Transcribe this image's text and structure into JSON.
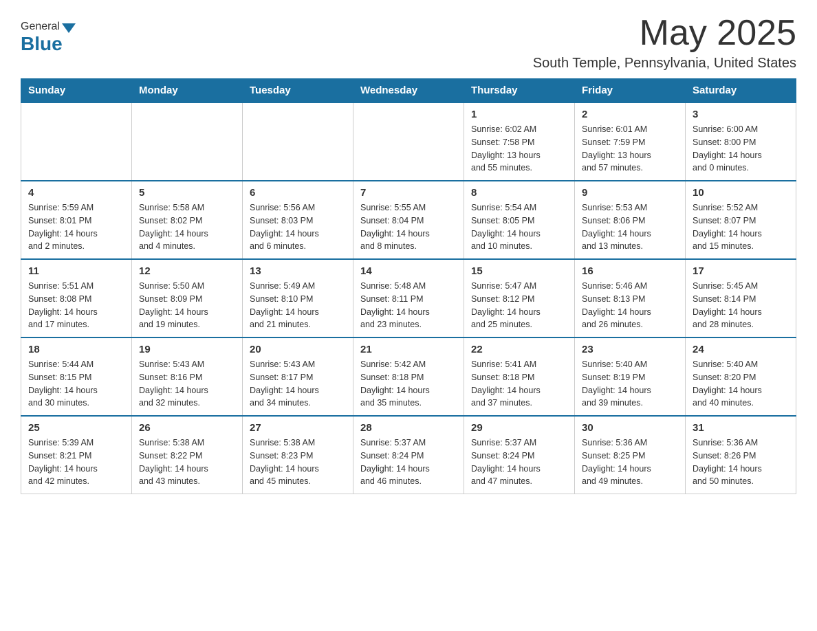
{
  "header": {
    "logo_general": "General",
    "logo_blue": "Blue",
    "month": "May 2025",
    "location": "South Temple, Pennsylvania, United States"
  },
  "days_of_week": [
    "Sunday",
    "Monday",
    "Tuesday",
    "Wednesday",
    "Thursday",
    "Friday",
    "Saturday"
  ],
  "weeks": [
    [
      {
        "day": "",
        "info": ""
      },
      {
        "day": "",
        "info": ""
      },
      {
        "day": "",
        "info": ""
      },
      {
        "day": "",
        "info": ""
      },
      {
        "day": "1",
        "info": "Sunrise: 6:02 AM\nSunset: 7:58 PM\nDaylight: 13 hours\nand 55 minutes."
      },
      {
        "day": "2",
        "info": "Sunrise: 6:01 AM\nSunset: 7:59 PM\nDaylight: 13 hours\nand 57 minutes."
      },
      {
        "day": "3",
        "info": "Sunrise: 6:00 AM\nSunset: 8:00 PM\nDaylight: 14 hours\nand 0 minutes."
      }
    ],
    [
      {
        "day": "4",
        "info": "Sunrise: 5:59 AM\nSunset: 8:01 PM\nDaylight: 14 hours\nand 2 minutes."
      },
      {
        "day": "5",
        "info": "Sunrise: 5:58 AM\nSunset: 8:02 PM\nDaylight: 14 hours\nand 4 minutes."
      },
      {
        "day": "6",
        "info": "Sunrise: 5:56 AM\nSunset: 8:03 PM\nDaylight: 14 hours\nand 6 minutes."
      },
      {
        "day": "7",
        "info": "Sunrise: 5:55 AM\nSunset: 8:04 PM\nDaylight: 14 hours\nand 8 minutes."
      },
      {
        "day": "8",
        "info": "Sunrise: 5:54 AM\nSunset: 8:05 PM\nDaylight: 14 hours\nand 10 minutes."
      },
      {
        "day": "9",
        "info": "Sunrise: 5:53 AM\nSunset: 8:06 PM\nDaylight: 14 hours\nand 13 minutes."
      },
      {
        "day": "10",
        "info": "Sunrise: 5:52 AM\nSunset: 8:07 PM\nDaylight: 14 hours\nand 15 minutes."
      }
    ],
    [
      {
        "day": "11",
        "info": "Sunrise: 5:51 AM\nSunset: 8:08 PM\nDaylight: 14 hours\nand 17 minutes."
      },
      {
        "day": "12",
        "info": "Sunrise: 5:50 AM\nSunset: 8:09 PM\nDaylight: 14 hours\nand 19 minutes."
      },
      {
        "day": "13",
        "info": "Sunrise: 5:49 AM\nSunset: 8:10 PM\nDaylight: 14 hours\nand 21 minutes."
      },
      {
        "day": "14",
        "info": "Sunrise: 5:48 AM\nSunset: 8:11 PM\nDaylight: 14 hours\nand 23 minutes."
      },
      {
        "day": "15",
        "info": "Sunrise: 5:47 AM\nSunset: 8:12 PM\nDaylight: 14 hours\nand 25 minutes."
      },
      {
        "day": "16",
        "info": "Sunrise: 5:46 AM\nSunset: 8:13 PM\nDaylight: 14 hours\nand 26 minutes."
      },
      {
        "day": "17",
        "info": "Sunrise: 5:45 AM\nSunset: 8:14 PM\nDaylight: 14 hours\nand 28 minutes."
      }
    ],
    [
      {
        "day": "18",
        "info": "Sunrise: 5:44 AM\nSunset: 8:15 PM\nDaylight: 14 hours\nand 30 minutes."
      },
      {
        "day": "19",
        "info": "Sunrise: 5:43 AM\nSunset: 8:16 PM\nDaylight: 14 hours\nand 32 minutes."
      },
      {
        "day": "20",
        "info": "Sunrise: 5:43 AM\nSunset: 8:17 PM\nDaylight: 14 hours\nand 34 minutes."
      },
      {
        "day": "21",
        "info": "Sunrise: 5:42 AM\nSunset: 8:18 PM\nDaylight: 14 hours\nand 35 minutes."
      },
      {
        "day": "22",
        "info": "Sunrise: 5:41 AM\nSunset: 8:18 PM\nDaylight: 14 hours\nand 37 minutes."
      },
      {
        "day": "23",
        "info": "Sunrise: 5:40 AM\nSunset: 8:19 PM\nDaylight: 14 hours\nand 39 minutes."
      },
      {
        "day": "24",
        "info": "Sunrise: 5:40 AM\nSunset: 8:20 PM\nDaylight: 14 hours\nand 40 minutes."
      }
    ],
    [
      {
        "day": "25",
        "info": "Sunrise: 5:39 AM\nSunset: 8:21 PM\nDaylight: 14 hours\nand 42 minutes."
      },
      {
        "day": "26",
        "info": "Sunrise: 5:38 AM\nSunset: 8:22 PM\nDaylight: 14 hours\nand 43 minutes."
      },
      {
        "day": "27",
        "info": "Sunrise: 5:38 AM\nSunset: 8:23 PM\nDaylight: 14 hours\nand 45 minutes."
      },
      {
        "day": "28",
        "info": "Sunrise: 5:37 AM\nSunset: 8:24 PM\nDaylight: 14 hours\nand 46 minutes."
      },
      {
        "day": "29",
        "info": "Sunrise: 5:37 AM\nSunset: 8:24 PM\nDaylight: 14 hours\nand 47 minutes."
      },
      {
        "day": "30",
        "info": "Sunrise: 5:36 AM\nSunset: 8:25 PM\nDaylight: 14 hours\nand 49 minutes."
      },
      {
        "day": "31",
        "info": "Sunrise: 5:36 AM\nSunset: 8:26 PM\nDaylight: 14 hours\nand 50 minutes."
      }
    ]
  ]
}
